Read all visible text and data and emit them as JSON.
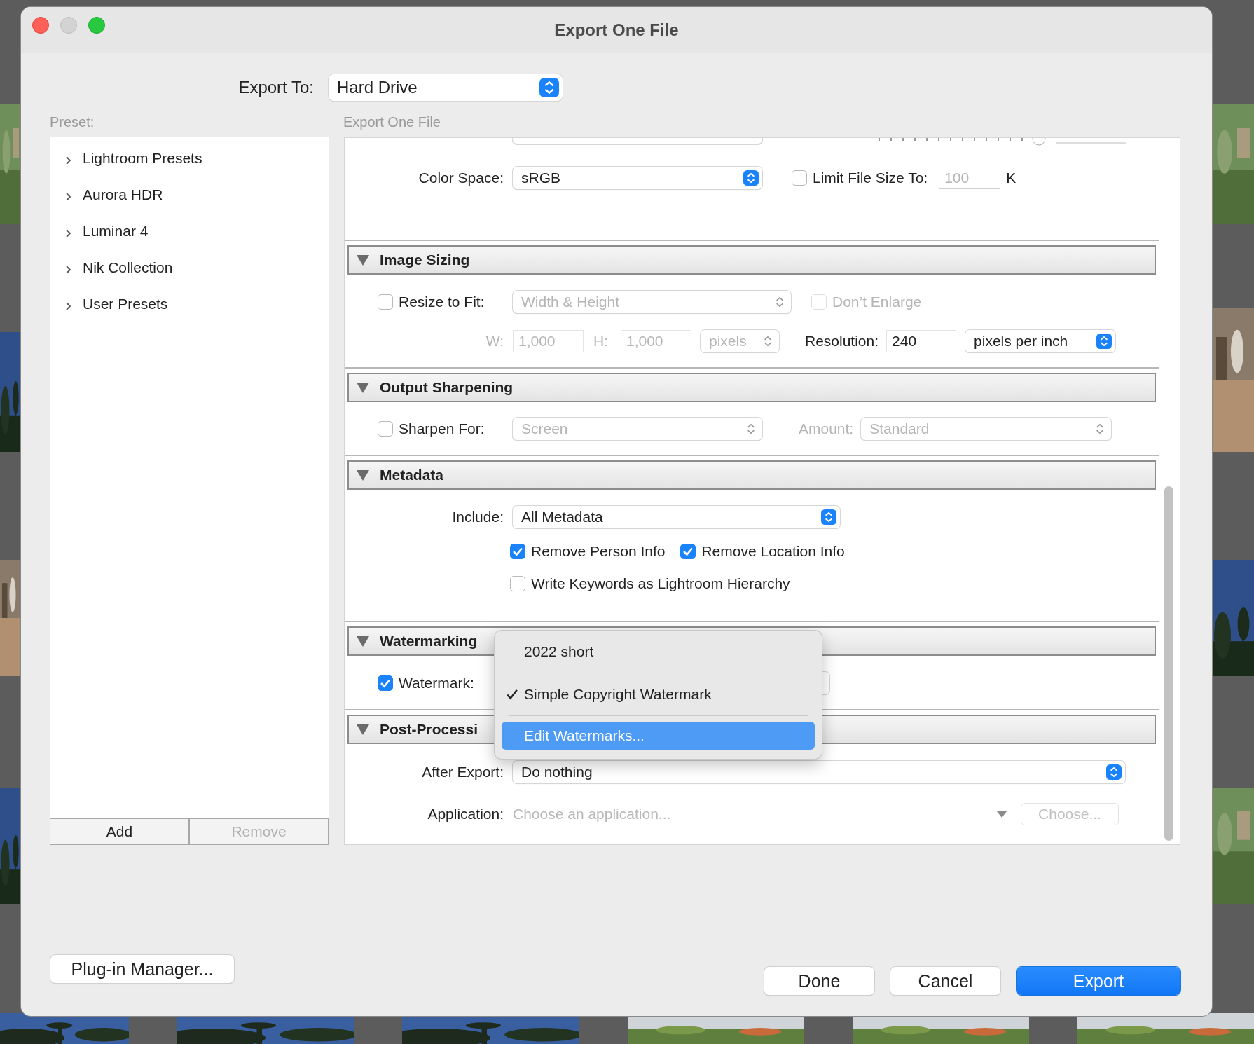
{
  "window": {
    "title": "Export One File"
  },
  "export_to": {
    "label": "Export To:",
    "value": "Hard Drive"
  },
  "preset": {
    "label": "Preset:",
    "items": [
      {
        "label": "Lightroom Presets",
        "expanded": false
      },
      {
        "label": "Aurora HDR",
        "expanded": false
      },
      {
        "label": "Luminar 4",
        "expanded": false
      },
      {
        "label": "Nik Collection",
        "expanded": false
      },
      {
        "label": "User Presets",
        "expanded": false
      }
    ],
    "buttons": [
      {
        "label": "Add",
        "disabled": false
      },
      {
        "label": "Remove",
        "disabled": true
      }
    ]
  },
  "settings_title": "Export One File",
  "file_settings": {
    "color_space": {
      "label": "Color Space:",
      "value": "sRGB"
    },
    "limit_file_size": {
      "label": "Limit File Size To:",
      "checked": false,
      "value": "100",
      "unit": "K"
    }
  },
  "image_sizing": {
    "title": "Image Sizing",
    "expanded": true,
    "resize": {
      "label": "Resize to Fit:",
      "checked": false,
      "value": "Width & Height"
    },
    "dont_enlarge": {
      "label": "Don’t Enlarge",
      "checked": false
    },
    "w": {
      "label": "W:",
      "value": "1,000"
    },
    "h": {
      "label": "H:",
      "value": "1,000"
    },
    "units": "pixels",
    "resolution": {
      "label": "Resolution:",
      "value": "240",
      "unit": "pixels per inch"
    }
  },
  "output_sharpening": {
    "title": "Output Sharpening",
    "expanded": true,
    "sharpen": {
      "label": "Sharpen For:",
      "checked": false,
      "value": "Screen"
    },
    "amount": {
      "label": "Amount:",
      "value": "Standard"
    }
  },
  "metadata": {
    "title": "Metadata",
    "expanded": true,
    "include": {
      "label": "Include:",
      "value": "All Metadata"
    },
    "options": [
      {
        "label": "Remove Person Info",
        "checked": true
      },
      {
        "label": "Remove Location Info",
        "checked": true
      },
      {
        "label": "Write Keywords as Lightroom Hierarchy",
        "checked": false
      }
    ]
  },
  "watermarking": {
    "title": "Watermarking",
    "expanded": true,
    "watermark": {
      "label": "Watermark:",
      "checked": true
    },
    "menu": [
      {
        "label": "2022 short",
        "checked": false,
        "selected": false
      },
      {
        "label": "Simple Copyright Watermark",
        "checked": true,
        "selected": false
      },
      {
        "label": "Edit Watermarks...",
        "checked": false,
        "selected": true
      }
    ]
  },
  "post_processing": {
    "title": "Post-Processi",
    "expanded": true,
    "after_export": {
      "label": "After Export:",
      "value": "Do nothing"
    },
    "application": {
      "label": "Application:",
      "placeholder": "Choose an application...",
      "choose": {
        "label": "Choose...",
        "disabled": true
      }
    }
  },
  "plugin_manager": "Plug-in Manager...",
  "buttons": [
    {
      "label": "Done",
      "kind": "normal"
    },
    {
      "label": "Cancel",
      "kind": "normal"
    },
    {
      "label": "Export",
      "kind": "default"
    }
  ]
}
